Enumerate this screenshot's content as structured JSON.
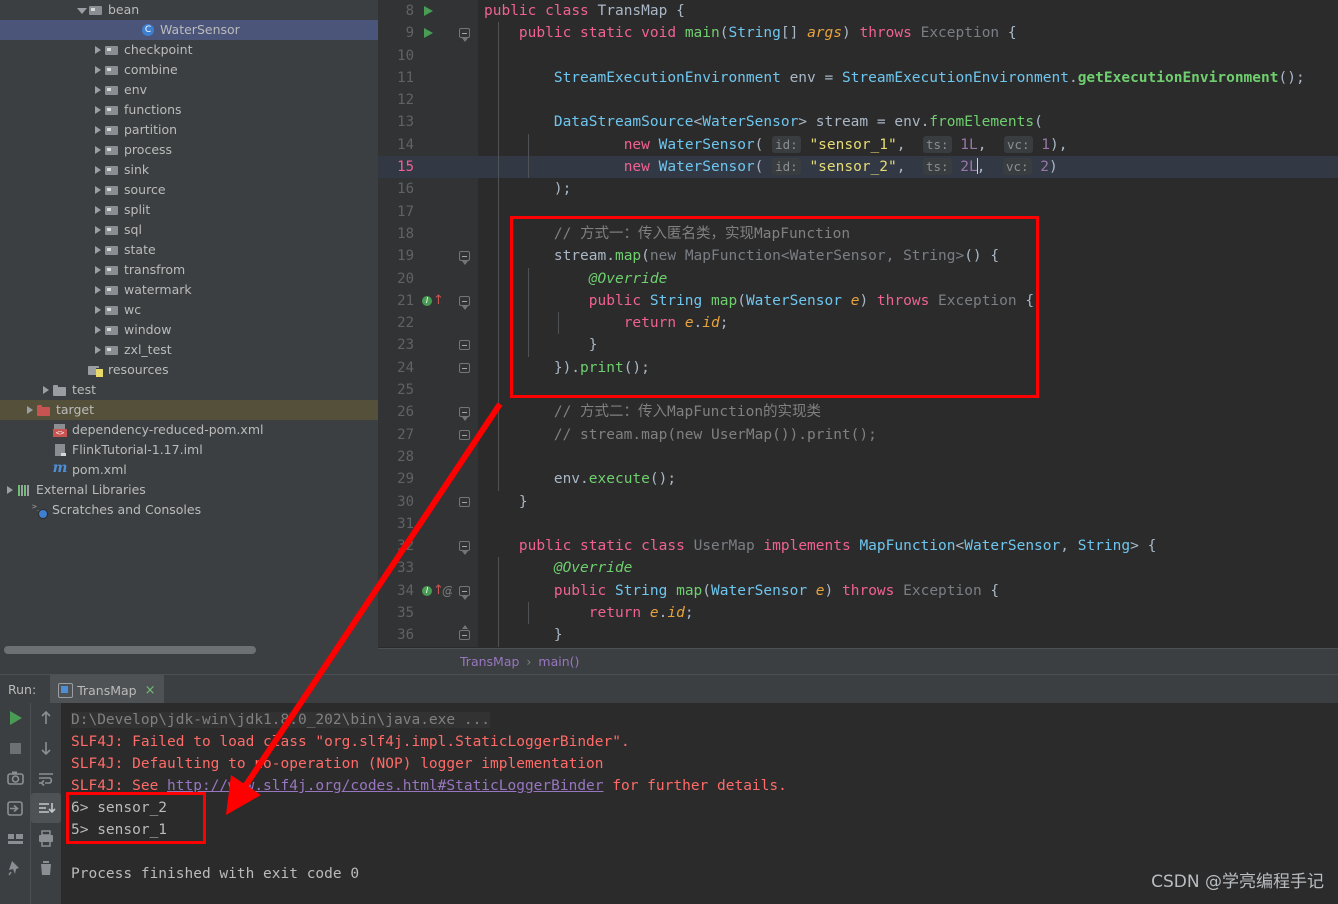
{
  "sidebar": {
    "items": [
      {
        "label": "bean",
        "icon": "package-icon",
        "twisty": "open",
        "indent": 76,
        "state": "normal"
      },
      {
        "label": "WaterSensor",
        "icon": "java-class-icon",
        "twisty": "none",
        "indent": 128,
        "state": "selected-blue"
      },
      {
        "label": "checkpoint",
        "icon": "package-icon",
        "twisty": "closed",
        "indent": 92,
        "state": "normal"
      },
      {
        "label": "combine",
        "icon": "package-icon",
        "twisty": "closed",
        "indent": 92,
        "state": "normal"
      },
      {
        "label": "env",
        "icon": "package-icon",
        "twisty": "closed",
        "indent": 92,
        "state": "normal"
      },
      {
        "label": "functions",
        "icon": "package-icon",
        "twisty": "closed",
        "indent": 92,
        "state": "normal"
      },
      {
        "label": "partition",
        "icon": "package-icon",
        "twisty": "closed",
        "indent": 92,
        "state": "normal"
      },
      {
        "label": "process",
        "icon": "package-icon",
        "twisty": "closed",
        "indent": 92,
        "state": "normal"
      },
      {
        "label": "sink",
        "icon": "package-icon",
        "twisty": "closed",
        "indent": 92,
        "state": "normal"
      },
      {
        "label": "source",
        "icon": "package-icon",
        "twisty": "closed",
        "indent": 92,
        "state": "normal"
      },
      {
        "label": "split",
        "icon": "package-icon",
        "twisty": "closed",
        "indent": 92,
        "state": "normal"
      },
      {
        "label": "sql",
        "icon": "package-icon",
        "twisty": "closed",
        "indent": 92,
        "state": "normal"
      },
      {
        "label": "state",
        "icon": "package-icon",
        "twisty": "closed",
        "indent": 92,
        "state": "normal"
      },
      {
        "label": "transfrom",
        "icon": "package-icon",
        "twisty": "closed",
        "indent": 92,
        "state": "normal"
      },
      {
        "label": "watermark",
        "icon": "package-icon",
        "twisty": "closed",
        "indent": 92,
        "state": "normal"
      },
      {
        "label": "wc",
        "icon": "package-icon",
        "twisty": "closed",
        "indent": 92,
        "state": "normal"
      },
      {
        "label": "window",
        "icon": "package-icon",
        "twisty": "closed",
        "indent": 92,
        "state": "normal"
      },
      {
        "label": "zxl_test",
        "icon": "package-icon",
        "twisty": "closed",
        "indent": 92,
        "state": "normal"
      },
      {
        "label": "resources",
        "icon": "resources-folder-icon",
        "twisty": "none",
        "indent": 76,
        "state": "normal"
      },
      {
        "label": "test",
        "icon": "folder-icon",
        "twisty": "closed",
        "indent": 40,
        "state": "normal"
      },
      {
        "label": "target",
        "icon": "folder-red-icon",
        "twisty": "closed",
        "indent": 24,
        "state": "selected-olive"
      },
      {
        "label": "dependency-reduced-pom.xml",
        "icon": "xml-file-icon",
        "twisty": "none",
        "indent": 40,
        "state": "normal"
      },
      {
        "label": "FlinkTutorial-1.17.iml",
        "icon": "iml-file-icon",
        "twisty": "none",
        "indent": 40,
        "state": "normal"
      },
      {
        "label": "pom.xml",
        "icon": "maven-icon",
        "twisty": "none",
        "indent": 40,
        "state": "normal"
      },
      {
        "label": "External Libraries",
        "icon": "libraries-icon",
        "twisty": "closed",
        "indent": 4,
        "state": "normal"
      },
      {
        "label": "Scratches and Consoles",
        "icon": "scratches-icon",
        "twisty": "none",
        "indent": 20,
        "state": "normal"
      }
    ]
  },
  "editor": {
    "lines": [
      {
        "n": "8",
        "gutter": "run",
        "fold": "",
        "current": false
      },
      {
        "n": "9",
        "gutter": "run",
        "fold": "down",
        "current": false
      },
      {
        "n": "10",
        "gutter": "",
        "fold": "",
        "current": false
      },
      {
        "n": "11",
        "gutter": "",
        "fold": "",
        "current": false
      },
      {
        "n": "12",
        "gutter": "",
        "fold": "",
        "current": false
      },
      {
        "n": "13",
        "gutter": "",
        "fold": "",
        "current": false
      },
      {
        "n": "14",
        "gutter": "",
        "fold": "",
        "current": false
      },
      {
        "n": "15",
        "gutter": "",
        "fold": "",
        "current": true
      },
      {
        "n": "16",
        "gutter": "",
        "fold": "",
        "current": false
      },
      {
        "n": "17",
        "gutter": "",
        "fold": "",
        "current": false
      },
      {
        "n": "18",
        "gutter": "",
        "fold": "",
        "current": false
      },
      {
        "n": "19",
        "gutter": "",
        "fold": "down",
        "current": false
      },
      {
        "n": "20",
        "gutter": "",
        "fold": "",
        "current": false
      },
      {
        "n": "21",
        "gutter": "override",
        "fold": "down",
        "current": false
      },
      {
        "n": "22",
        "gutter": "",
        "fold": "",
        "current": false
      },
      {
        "n": "23",
        "gutter": "",
        "fold": "plain",
        "current": false
      },
      {
        "n": "24",
        "gutter": "",
        "fold": "plain",
        "current": false
      },
      {
        "n": "25",
        "gutter": "",
        "fold": "",
        "current": false
      },
      {
        "n": "26",
        "gutter": "",
        "fold": "down",
        "current": false
      },
      {
        "n": "27",
        "gutter": "",
        "fold": "plain",
        "current": false
      },
      {
        "n": "28",
        "gutter": "",
        "fold": "",
        "current": false
      },
      {
        "n": "29",
        "gutter": "",
        "fold": "",
        "current": false
      },
      {
        "n": "30",
        "gutter": "",
        "fold": "plain",
        "current": false
      },
      {
        "n": "31",
        "gutter": "",
        "fold": "",
        "current": false
      },
      {
        "n": "32",
        "gutter": "",
        "fold": "down",
        "current": false
      },
      {
        "n": "33",
        "gutter": "",
        "fold": "",
        "current": false
      },
      {
        "n": "34",
        "gutter": "override-at",
        "fold": "down",
        "current": false
      },
      {
        "n": "35",
        "gutter": "",
        "fold": "",
        "current": false
      },
      {
        "n": "36",
        "gutter": "",
        "fold": "up",
        "current": false
      }
    ],
    "code_text": {
      "l8": "public class TransMap {",
      "l9": "public static void main(String[] args) throws Exception {",
      "l11": "StreamExecutionEnvironment env = StreamExecutionEnvironment.getExecutionEnvironment();",
      "l13": "DataStreamSource<WaterSensor> stream = env.fromElements(",
      "l14": "new WaterSensor( id: \"sensor_1\",  ts: 1L,  vc: 1),",
      "l15": "new WaterSensor( id: \"sensor_2\",  ts: 2L,  vc: 2)",
      "l16": ");",
      "l18": "// 方式一：传入匿名类，实现MapFunction",
      "l19": "stream.map(new MapFunction<WaterSensor, String>() {",
      "l20": "@Override",
      "l21": "public String map(WaterSensor e) throws Exception {",
      "l22": "return e.id;",
      "l23": "}",
      "l24": "}).print();",
      "l26": "// 方式二：传入MapFunction的实现类",
      "l27": "// stream.map(new UserMap()).print();",
      "l29": "env.execute();",
      "l30": "}",
      "l32": "public static class UserMap implements MapFunction<WaterSensor, String> {",
      "l33": "@Override",
      "l34": "public String map(WaterSensor e) throws Exception {",
      "l35": "return e.id;",
      "l36": "}"
    },
    "hints": {
      "id": "id:",
      "ts": "ts:",
      "vc": "vc:"
    }
  },
  "breadcrumb": {
    "class": "TransMap",
    "separator": "›",
    "method": "main()"
  },
  "run_panel": {
    "run_label": "Run:",
    "tab_name": "TransMap",
    "tab_close": "×",
    "toolbar_left": [
      {
        "name": "rerun-button",
        "glyph": "run"
      },
      {
        "name": "stop-button",
        "glyph": "stop"
      },
      {
        "name": "screenshot-button",
        "glyph": "camera"
      },
      {
        "name": "export-button",
        "glyph": "export"
      },
      {
        "name": "layout-button",
        "glyph": "layout"
      },
      {
        "name": "pin-button",
        "glyph": "pin"
      }
    ],
    "toolbar_right": [
      {
        "name": "scroll-up-button",
        "glyph": "arrow-up"
      },
      {
        "name": "scroll-down-button",
        "glyph": "arrow-down"
      },
      {
        "name": "soft-wrap-button",
        "glyph": "wrap"
      },
      {
        "name": "scroll-to-end-button",
        "glyph": "scroll-end",
        "active": true
      },
      {
        "name": "print-button",
        "glyph": "printer"
      },
      {
        "name": "clear-all-button",
        "glyph": "trash"
      }
    ],
    "console": [
      {
        "kind": "cmd",
        "text": "D:\\Develop\\jdk-win\\jdk1.8.0_202\\bin\\java.exe ..."
      },
      {
        "kind": "err",
        "text": "SLF4J: Failed to load class \"org.slf4j.impl.StaticLoggerBinder\"."
      },
      {
        "kind": "err",
        "text": "SLF4J: Defaulting to no-operation (NOP) logger implementation"
      },
      {
        "kind": "link",
        "pre": "SLF4J: See ",
        "link": "http://www.slf4j.org/codes.html#StaticLoggerBinder",
        "post": " for further details."
      },
      {
        "kind": "out",
        "text": "6> sensor_2"
      },
      {
        "kind": "out",
        "text": "5> sensor_1"
      },
      {
        "kind": "blank",
        "text": ""
      },
      {
        "kind": "out",
        "text": "Process finished with exit code 0"
      }
    ]
  },
  "annotations": {
    "box_color": "#ff0000",
    "arrow_color": "#ff0000",
    "watermark": "CSDN @学亮编程手记"
  }
}
